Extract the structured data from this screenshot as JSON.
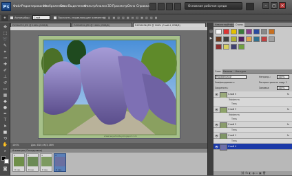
{
  "app": {
    "logo": "Ps",
    "workspace": "Основная рабочая среда"
  },
  "menu": [
    "Файл",
    "Редактирование",
    "Изображение",
    "Слои",
    "Выделение",
    "Фильтр",
    "Анализ",
    "3D",
    "Просмотр",
    "Окно",
    "Справка"
  ],
  "options": {
    "autoselect_label": "Автовыбор:",
    "autoselect_value": "Слой",
    "show_controls_label": "Показать управляющие элементы"
  },
  "tabs": [
    {
      "label": "P4250033.JPG @ 100% (RGB/8)"
    },
    {
      "label": "P4250034.JPG @ 100% (RGB/8)"
    },
    {
      "label": "P4250036.JPG @ 100% (Слой 4, RGB/8)"
    }
  ],
  "status": {
    "zoom": "100%",
    "doc": "Док: 810,0К/3,16М"
  },
  "animation": {
    "title": "Анимация (Покадровая)",
    "frames": [
      {
        "num": "1",
        "delay": "0 сек.",
        "color": "#6f8f4a"
      },
      {
        "num": "2",
        "delay": "0 сек.",
        "color": "#6b8a55"
      },
      {
        "num": "3",
        "delay": "0 сек.",
        "color": "#7d9a60"
      },
      {
        "num": "4",
        "delay": "0 сек.",
        "color": "#6a6fa0"
      }
    ]
  },
  "panels": {
    "tabs_top": [
      "Навигатор",
      "Инфо",
      "Стили"
    ],
    "tabs_layers": [
      "Слои",
      "Каналы",
      "Контуры"
    ],
    "blend_mode": "Нормальный",
    "opacity_label": "Непрозр.:",
    "opacity_value": "100%",
    "unify_label": "Унифицировать:",
    "propagate_label": "Распространить кадр 1",
    "lock_label": "Закрепить:",
    "fill_label": "Заливка:",
    "fill_value": "100%",
    "layers": [
      {
        "name": "Слой 5",
        "kind": "layer",
        "thumb": "#9aaa7a"
      },
      {
        "name": "Эффекты",
        "kind": "sub"
      },
      {
        "name": "Тень",
        "kind": "sub"
      },
      {
        "name": "Слой 3",
        "kind": "layer",
        "thumb": "#8ea36a"
      },
      {
        "name": "Эффекты",
        "kind": "sub"
      },
      {
        "name": "Тень",
        "kind": "sub"
      },
      {
        "name": "Слой 2",
        "kind": "layer",
        "thumb": "#8a9c6c"
      },
      {
        "name": "Тень",
        "kind": "sub"
      },
      {
        "name": "Слой 1",
        "kind": "layer",
        "thumb": "#7f9566"
      },
      {
        "name": "Тень",
        "kind": "sub"
      },
      {
        "name": "Слой 4",
        "kind": "layer",
        "thumb": "#6c6ea8",
        "selected": true
      }
    ]
  },
  "watermark": "www.lesyaholiday.blogspot.com"
}
